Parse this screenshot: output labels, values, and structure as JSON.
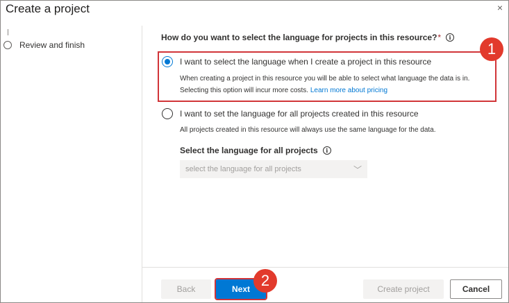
{
  "dialog": {
    "title": "Create a project",
    "close_icon": "×"
  },
  "sidebar": {
    "steps": [
      {
        "label": "Review and finish"
      }
    ]
  },
  "question": {
    "text": "How do you want to select the language for projects in this resource?",
    "required_marker": "*",
    "info_icon": "i"
  },
  "options": [
    {
      "label": "I want to select the language when I create a project in this resource",
      "selected": true,
      "description_line1": "When creating a project in this resource you will be able to select what language the data is in.",
      "description_line2": "Selecting this option will incur more costs.",
      "link_text": "Learn more about pricing"
    },
    {
      "label": "I want to set the language for all projects created in this resource",
      "selected": false,
      "description_line1": "All projects created in this resource will always use the same language for the data."
    }
  ],
  "language_select": {
    "label": "Select the language for all projects",
    "info_icon": "i",
    "placeholder": "select the language for all projects",
    "chevron": "﹀"
  },
  "badges": [
    "1",
    "2"
  ],
  "footer": {
    "back": "Back",
    "next": "Next",
    "create": "Create project",
    "cancel": "Cancel"
  },
  "colors": {
    "accent": "#0078d4",
    "highlight": "#d13438",
    "badge": "#e23a2c"
  }
}
